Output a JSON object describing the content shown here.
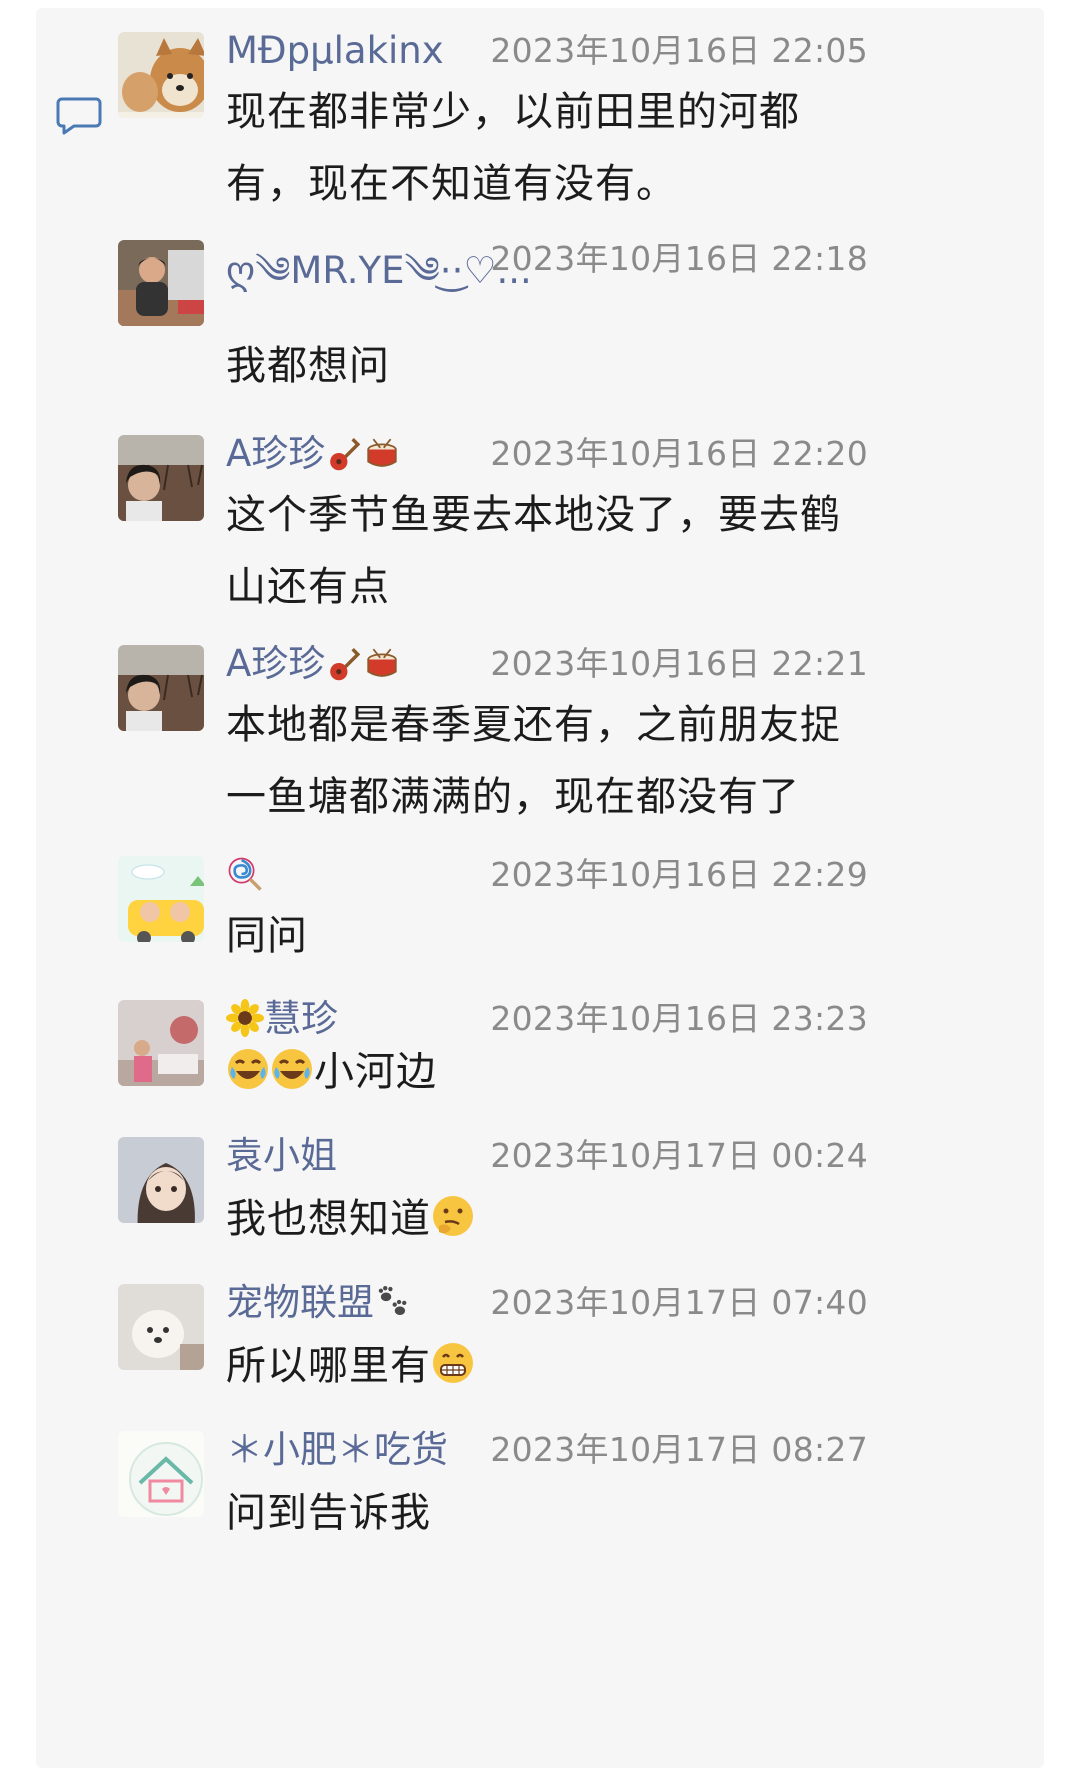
{
  "comments": [
    {
      "name": "MĐpµlakinx",
      "time": "2023年10月16日 22:05",
      "text": "现在都非常少，以前田里的河都有，现在不知道有没有。",
      "avatar_icon": "shiba-dog-avatar"
    },
    {
      "name": "ღ༄MR.YE༄·͜·♡...",
      "time": "2023年10月16日 22:18",
      "text": "我都想问",
      "avatar_icon": "man-photo-avatar"
    },
    {
      "name": "A珍珍",
      "name_emojis": [
        "guitar-emoji",
        "drum-emoji"
      ],
      "time": "2023年10月16日 22:20",
      "text": "这个季节鱼要去本地没了，要去鹤山还有点",
      "avatar_icon": "woman-field-avatar"
    },
    {
      "name": "A珍珍",
      "name_emojis": [
        "guitar-emoji",
        "drum-emoji"
      ],
      "time": "2023年10月16日 22:21",
      "text": "本地都是春季夏还有，之前朋友捉一鱼塘都满满的，现在都没有了",
      "avatar_icon": "woman-field-avatar"
    },
    {
      "name": "",
      "name_emojis": [
        "lollipop-emoji"
      ],
      "time": "2023年10月16日 22:29",
      "text": "同问",
      "avatar_icon": "kids-cartoon-avatar"
    },
    {
      "name": "慧珍",
      "name_prefix_emoji": "sunflower-emoji",
      "time": "2023年10月16日 23:23",
      "text": "小河边",
      "text_prefix_emojis": [
        "laugh-cry-emoji",
        "laugh-cry-emoji"
      ],
      "avatar_icon": "room-photo-avatar"
    },
    {
      "name": "袁小姐",
      "time": "2023年10月17日 00:24",
      "text": "我也想知道",
      "text_suffix_emoji": "thinking-emoji",
      "avatar_icon": "anime-girl-avatar"
    },
    {
      "name": "宠物联盟",
      "name_emojis": [
        "paw-prints-emoji"
      ],
      "time": "2023年10月17日 07:40",
      "text": "所以哪里有",
      "text_suffix_emoji": "grin-emoji",
      "avatar_icon": "white-dog-avatar"
    },
    {
      "name": "＊小肥＊吃货",
      "time": "2023年10月17日 08:27",
      "text": "问到告诉我",
      "avatar_icon": "house-logo-avatar"
    }
  ],
  "icons": {
    "comment": "comment-bubble-icon"
  },
  "colors": {
    "name": "#5a6a96",
    "time": "#8a8a8a",
    "text": "#1c1c1c",
    "icon": "#4a7ab4"
  }
}
